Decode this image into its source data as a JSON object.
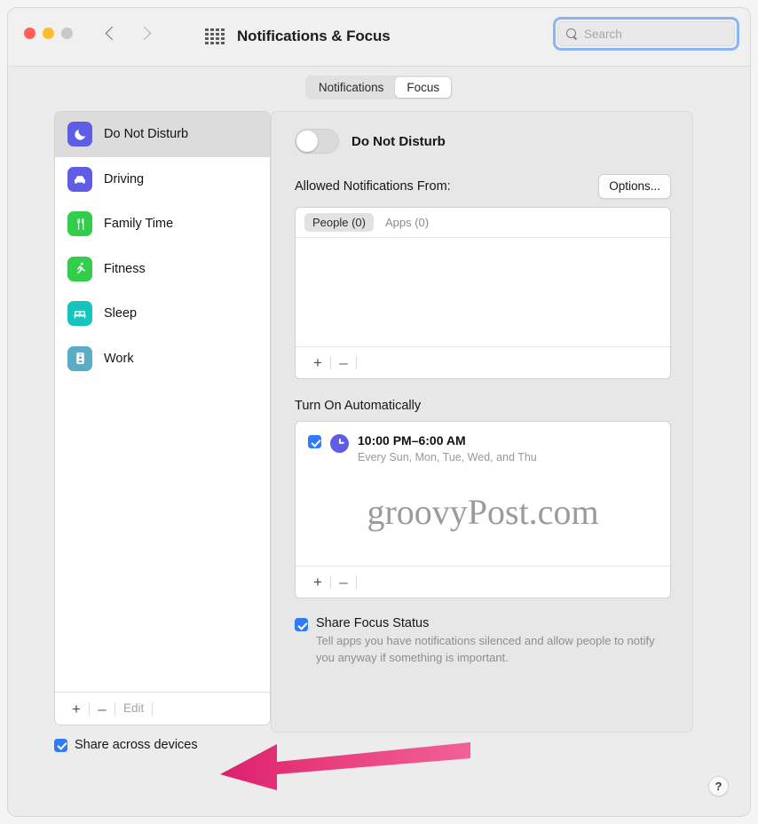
{
  "window": {
    "title": "Notifications & Focus",
    "traffic_lights": [
      "close-red",
      "minimize-yellow",
      "zoom-gray-disabled"
    ],
    "nav": {
      "back_icon": "chevron-left-icon",
      "forward_icon": "chevron-right-icon",
      "grid_icon": "show-all-grid-icon"
    },
    "search": {
      "placeholder": "Search",
      "value": "",
      "icon": "search-icon",
      "focused": true
    }
  },
  "tabs": {
    "items": [
      {
        "label": "Notifications",
        "selected": false
      },
      {
        "label": "Focus",
        "selected": true
      }
    ]
  },
  "sidebar": {
    "items": [
      {
        "label": "Do Not Disturb",
        "icon": "moon-icon",
        "color": "#5f5ce6",
        "selected": true
      },
      {
        "label": "Driving",
        "icon": "car-icon",
        "color": "#5f5ce6",
        "selected": false
      },
      {
        "label": "Family Time",
        "icon": "fork-knife-icon",
        "color": "#32cd4a",
        "selected": false
      },
      {
        "label": "Fitness",
        "icon": "running-person-icon",
        "color": "#32cd4a",
        "selected": false
      },
      {
        "label": "Sleep",
        "icon": "bed-icon",
        "color": "#14c4bd",
        "selected": false
      },
      {
        "label": "Work",
        "icon": "id-badge-icon",
        "color": "#5aadc4",
        "selected": false
      }
    ],
    "footer": {
      "add": "+",
      "remove": "–",
      "edit": "Edit"
    },
    "share_across_devices": {
      "label": "Share across devices",
      "checked": true
    }
  },
  "panel": {
    "focus_toggle": {
      "label": "Do Not Disturb",
      "on": false
    },
    "allowed": {
      "label": "Allowed Notifications From:",
      "options_button": "Options...",
      "tabs": [
        {
          "label": "People (0)",
          "selected": true
        },
        {
          "label": "Apps (0)",
          "selected": false
        }
      ],
      "footer": {
        "add": "+",
        "remove": "–"
      }
    },
    "turn_on_automatically": {
      "label": "Turn On Automatically",
      "schedule": {
        "checked": true,
        "icon": "clock-icon",
        "time": "10:00 PM–6:00 AM",
        "days": "Every Sun, Mon, Tue, Wed, and Thu"
      },
      "footer": {
        "add": "+",
        "remove": "–"
      }
    },
    "share_focus_status": {
      "checked": true,
      "title": "Share Focus Status",
      "description": "Tell apps you have notifications silenced and allow people to notify you anyway if something is important."
    },
    "help_button": "?"
  },
  "watermark": "groovyPost.com",
  "annotation": {
    "arrow": "left-pointing-arrow",
    "color_head": "#dd1f6e",
    "color_tail": "#f26196",
    "points_at": "Share across devices"
  },
  "colors": {
    "accent_blue": "#2f7cf6",
    "focus_ring": "#8cb4f0",
    "window_bg": "#ececec",
    "panel_bg": "#e7e7e7"
  }
}
